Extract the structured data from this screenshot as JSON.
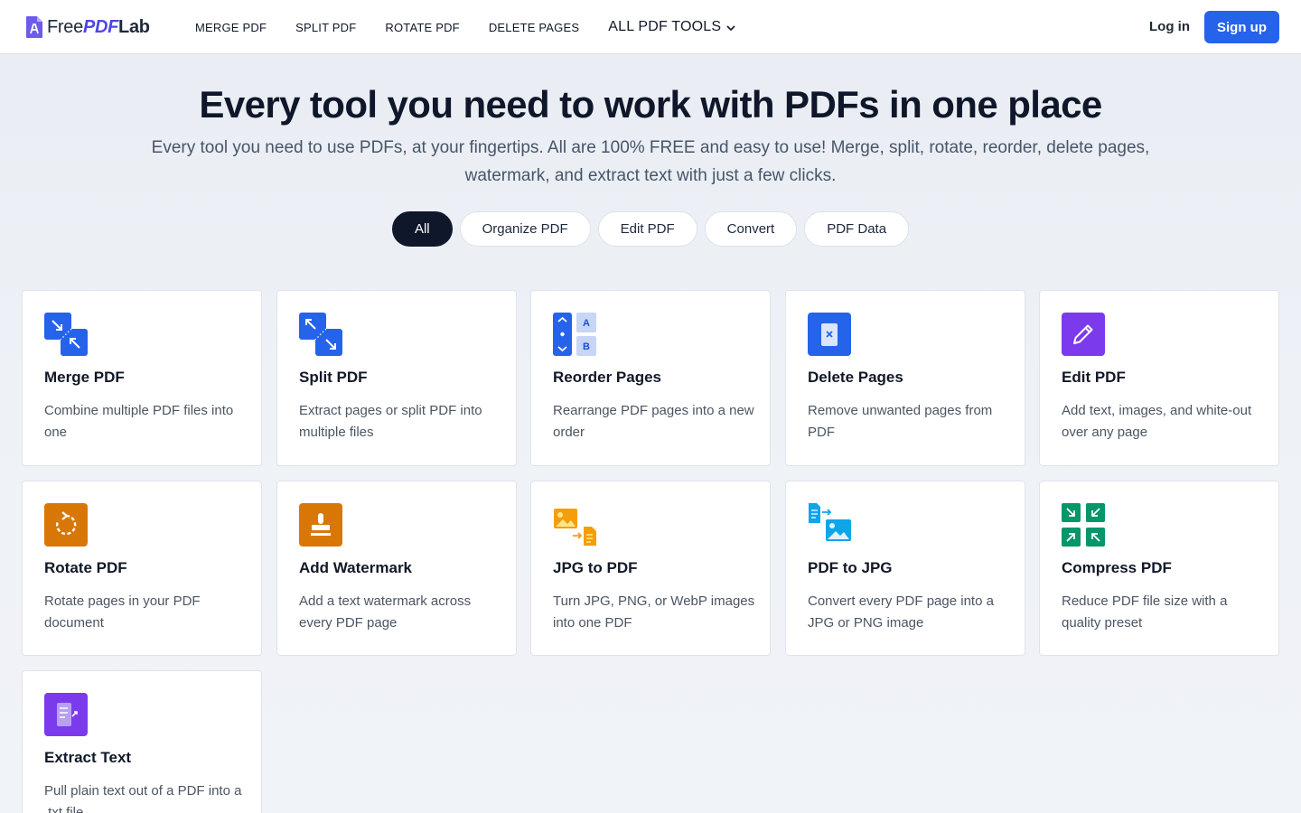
{
  "header": {
    "logo": {
      "part1": "Free",
      "part2": "PDF",
      "part3": "Lab"
    },
    "nav": [
      "MERGE PDF",
      "SPLIT PDF",
      "ROTATE PDF",
      "DELETE PAGES"
    ],
    "all_tools_label": "ALL PDF TOOLS",
    "login_label": "Log in",
    "signup_label": "Sign up"
  },
  "hero": {
    "title": "Every tool you need to work with PDFs in one place",
    "subtitle": "Every tool you need to use PDFs, at your fingertips. All are 100% FREE and easy to use! Merge, split, rotate, reorder, delete pages, watermark, and extract text with just a few clicks."
  },
  "filters": [
    {
      "label": "All",
      "active": true
    },
    {
      "label": "Organize PDF",
      "active": false
    },
    {
      "label": "Edit PDF",
      "active": false
    },
    {
      "label": "Convert",
      "active": false
    },
    {
      "label": "PDF Data",
      "active": false
    }
  ],
  "tools": [
    {
      "title": "Merge PDF",
      "description": "Combine multiple PDF files into one",
      "icon": "merge-icon",
      "color": "#2563eb"
    },
    {
      "title": "Split PDF",
      "description": "Extract pages or split PDF into multiple files",
      "icon": "split-icon",
      "color": "#2563eb"
    },
    {
      "title": "Reorder Pages",
      "description": "Rearrange PDF pages into a new order",
      "icon": "reorder-icon",
      "color": "#2563eb"
    },
    {
      "title": "Delete Pages",
      "description": "Remove unwanted pages from PDF",
      "icon": "delete-page-icon",
      "color": "#2563eb"
    },
    {
      "title": "Edit PDF",
      "description": "Add text, images, and white-out over any page",
      "icon": "pencil-icon",
      "color": "#7c3aed"
    },
    {
      "title": "Rotate PDF",
      "description": "Rotate pages in your PDF document",
      "icon": "rotate-icon",
      "color": "#d97706"
    },
    {
      "title": "Add Watermark",
      "description": "Add a text watermark across every PDF page",
      "icon": "stamp-icon",
      "color": "#d97706"
    },
    {
      "title": "JPG to PDF",
      "description": "Turn JPG, PNG, or WebP images into one PDF",
      "icon": "image-to-pdf-icon",
      "color": "#f59e0b"
    },
    {
      "title": "PDF to JPG",
      "description": "Convert every PDF page into a JPG or PNG image",
      "icon": "pdf-to-image-icon",
      "color": "#0ea5e9"
    },
    {
      "title": "Compress PDF",
      "description": "Reduce PDF file size with a quality preset",
      "icon": "compress-icon",
      "color": "#059669"
    },
    {
      "title": "Extract Text",
      "description": "Pull plain text out of a PDF into a .txt file",
      "icon": "extract-text-icon",
      "color": "#7c3aed"
    }
  ]
}
